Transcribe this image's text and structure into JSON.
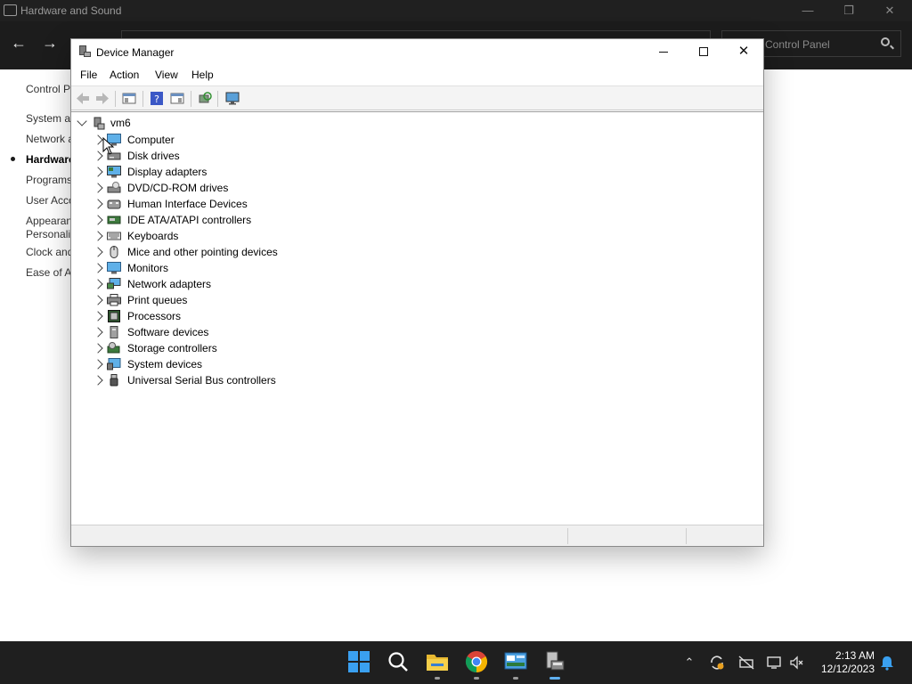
{
  "control_panel": {
    "title": "Hardware and Sound",
    "search_placeholder": "Control Panel",
    "sidebar": [
      "Control P",
      "System ar",
      "Network a",
      "Hardware",
      "Programs",
      "User Acco",
      "Appearan",
      "Personaliz",
      "Clock and",
      "Ease of Ac"
    ]
  },
  "device_manager": {
    "title": "Device Manager",
    "menu": [
      "File",
      "Action",
      "View",
      "Help"
    ],
    "root": "vm6",
    "categories": [
      {
        "label": "Computer",
        "icon": "computer-icon"
      },
      {
        "label": "Disk drives",
        "icon": "disk-drive-icon"
      },
      {
        "label": "Display adapters",
        "icon": "display-adapter-icon"
      },
      {
        "label": "DVD/CD-ROM drives",
        "icon": "dvd-drive-icon"
      },
      {
        "label": "Human Interface Devices",
        "icon": "hid-icon"
      },
      {
        "label": "IDE ATA/ATAPI controllers",
        "icon": "ide-controller-icon"
      },
      {
        "label": "Keyboards",
        "icon": "keyboard-icon"
      },
      {
        "label": "Mice and other pointing devices",
        "icon": "mouse-icon"
      },
      {
        "label": "Monitors",
        "icon": "monitor-icon"
      },
      {
        "label": "Network adapters",
        "icon": "network-adapter-icon"
      },
      {
        "label": "Print queues",
        "icon": "printer-icon"
      },
      {
        "label": "Processors",
        "icon": "processor-icon"
      },
      {
        "label": "Software devices",
        "icon": "software-device-icon"
      },
      {
        "label": "Storage controllers",
        "icon": "storage-controller-icon"
      },
      {
        "label": "System devices",
        "icon": "system-device-icon"
      },
      {
        "label": "Universal Serial Bus controllers",
        "icon": "usb-icon"
      }
    ]
  },
  "taskbar": {
    "time": "2:13 AM",
    "date": "12/12/2023"
  }
}
